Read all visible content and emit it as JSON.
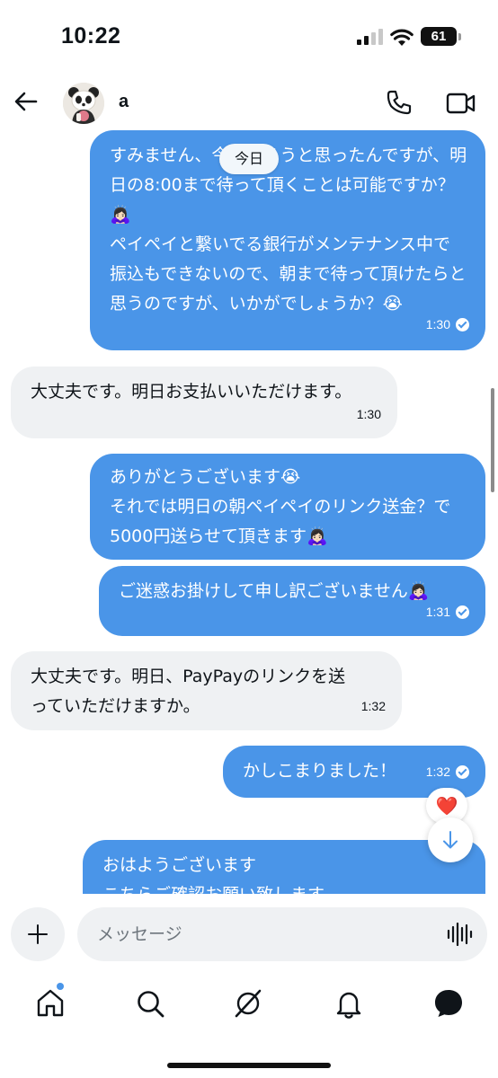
{
  "status_bar": {
    "time": "10:22",
    "battery": "61"
  },
  "header": {
    "contact_name": "a"
  },
  "date_divider": "今日",
  "messages": [
    {
      "direction": "out",
      "text": "すみません、今日払ろうと思ったんですが、明日の8:00まで待って頂くことは可能ですか？🙇🏻‍♀️\nペイペイと繋いでる銀行がメンテナンス中で振込もできないので、朝まで待って頂けたらと思うのですが、いかがでしょうか？😭",
      "time": "1:30",
      "read": true
    },
    {
      "direction": "in",
      "text": "大丈夫です。明日お支払いいただけます。",
      "time": "1:30"
    },
    {
      "direction": "out",
      "text": "ありがとうございます😭\nそれでは明日の朝ペイペイのリンク送金？で5000円送らせて頂きます🙇🏻‍♀️",
      "time": "",
      "read": false
    },
    {
      "direction": "out",
      "text": "ご迷惑お掛けして申し訳ございません🙇🏻‍♀️",
      "time": "1:31",
      "read": true
    },
    {
      "direction": "in",
      "text": "大丈夫です。明日、PayPayのリンクを送っていただけますか。",
      "time": "1:32"
    },
    {
      "direction": "out",
      "text": "かしこまりました！",
      "time": "1:32",
      "read": true,
      "reaction": "❤️"
    },
    {
      "direction": "out",
      "text": "おはようございます\nこちらご確認お願い致します",
      "time": "",
      "read": false
    }
  ],
  "composer": {
    "placeholder": "メッセージ"
  },
  "nav": {
    "items": [
      "home-icon",
      "search-icon",
      "grok-icon",
      "notifications-icon",
      "messages-icon"
    ],
    "home_has_dot": true
  },
  "colors": {
    "accent": "#4a95e8",
    "incoming": "#eff1f3",
    "text": "#0f1419"
  }
}
